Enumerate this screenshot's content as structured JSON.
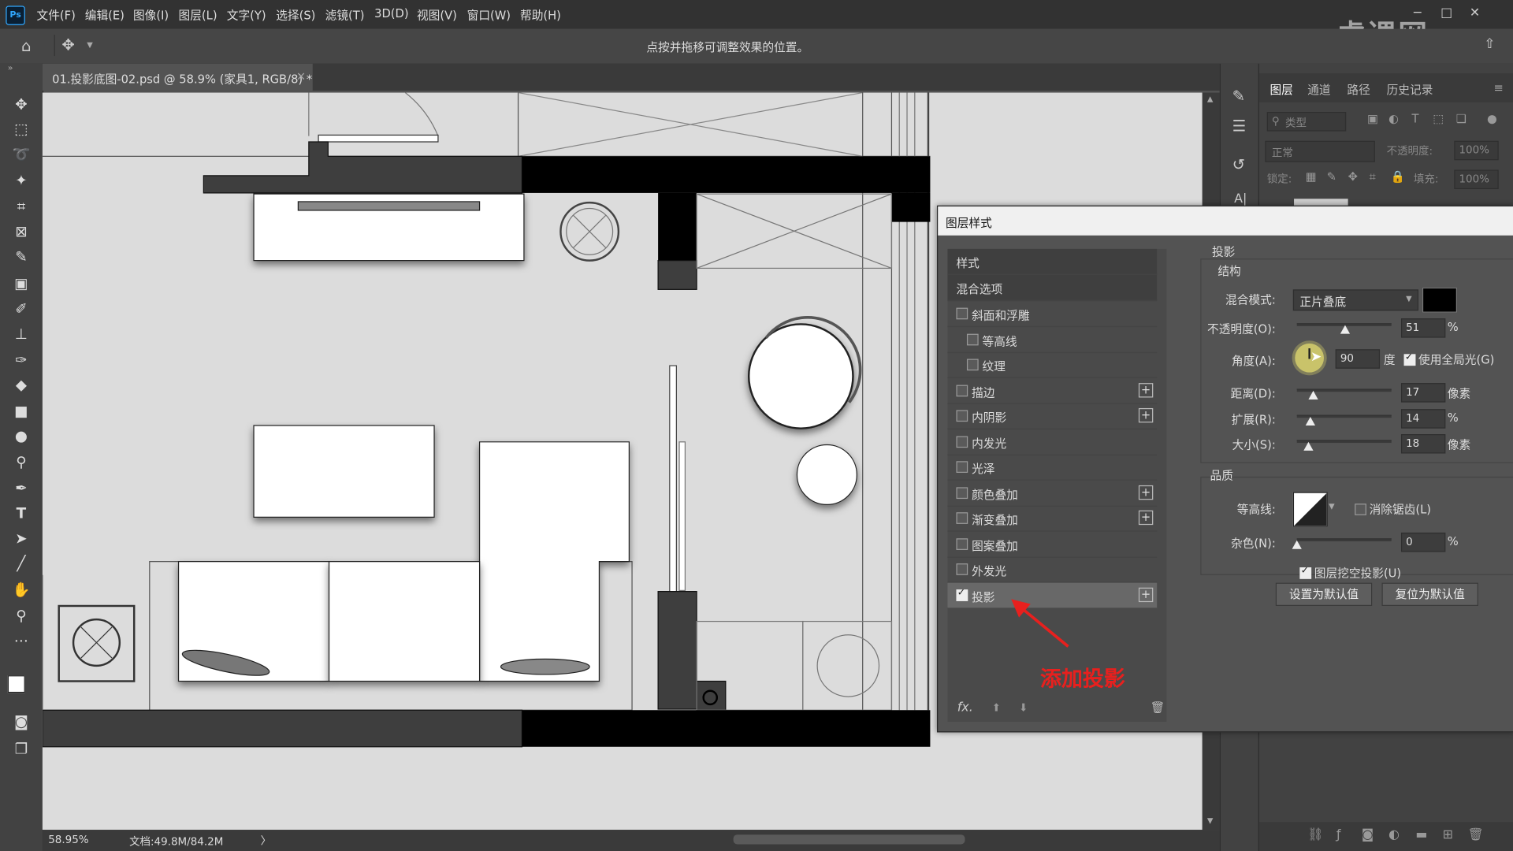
{
  "menu": {
    "logo": "Ps",
    "items": [
      "文件(F)",
      "编辑(E)",
      "图像(I)",
      "图层(L)",
      "文字(Y)",
      "选择(S)",
      "滤镜(T)",
      "3D(D)",
      "视图(V)",
      "窗口(W)",
      "帮助(H)"
    ]
  },
  "watermark": "虎课网",
  "options_bar": {
    "hint": "点按并拖移可调整效果的位置。"
  },
  "document": {
    "tab_title": "01.投影底图-02.psd @ 58.9% (家具1, RGB/8) *",
    "tab_close": "×"
  },
  "status": {
    "zoom": "58.95%",
    "doc_size": "文档:49.8M/84.2M",
    "arrow": "〉"
  },
  "layers_panel": {
    "tabs": [
      "图层",
      "通道",
      "路径",
      "历史记录"
    ],
    "filter_label": "类型",
    "blend_mode": "正常",
    "opacity_label": "不透明度:",
    "opacity_value": "100%",
    "lock_label": "锁定:",
    "fill_label": "填充:",
    "fill_value": "100%"
  },
  "dialog": {
    "title": "图层样式",
    "styles_header": "样式",
    "blend_options": "混合选项",
    "style_items": [
      {
        "label": "斜面和浮雕",
        "checked": false,
        "plus": false,
        "indent": false
      },
      {
        "label": "等高线",
        "checked": false,
        "plus": false,
        "indent": true
      },
      {
        "label": "纹理",
        "checked": false,
        "plus": false,
        "indent": true
      },
      {
        "label": "描边",
        "checked": false,
        "plus": true,
        "indent": false
      },
      {
        "label": "内阴影",
        "checked": false,
        "plus": true,
        "indent": false
      },
      {
        "label": "内发光",
        "checked": false,
        "plus": false,
        "indent": false
      },
      {
        "label": "光泽",
        "checked": false,
        "plus": false,
        "indent": false
      },
      {
        "label": "颜色叠加",
        "checked": false,
        "plus": true,
        "indent": false
      },
      {
        "label": "渐变叠加",
        "checked": false,
        "plus": true,
        "indent": false
      },
      {
        "label": "图案叠加",
        "checked": false,
        "plus": false,
        "indent": false
      },
      {
        "label": "外发光",
        "checked": false,
        "plus": false,
        "indent": false
      },
      {
        "label": "投影",
        "checked": true,
        "plus": true,
        "indent": false
      }
    ],
    "fx_label": "fx.",
    "annotation": "添加投影",
    "annotation_color": "#e8201e",
    "section_title": "投影",
    "structure_label": "结构",
    "blend_mode_label": "混合模式:",
    "blend_mode_value": "正片叠底",
    "shadow_color": "#000000",
    "opacity_label": "不透明度(O):",
    "opacity_value": "51",
    "opacity_unit": "%",
    "angle_label": "角度(A):",
    "angle_value": "90",
    "angle_unit": "度",
    "global_light_label": "使用全局光(G)",
    "global_light_checked": true,
    "distance_label": "距离(D):",
    "distance_value": "17",
    "distance_unit": "像素",
    "spread_label": "扩展(R):",
    "spread_value": "14",
    "spread_unit": "%",
    "size_label": "大小(S):",
    "size_value": "18",
    "size_unit": "像素",
    "quality_label": "品质",
    "contour_label": "等高线:",
    "antialias_label": "消除锯齿(L)",
    "antialias_checked": false,
    "noise_label": "杂色(N):",
    "noise_value": "0",
    "noise_unit": "%",
    "knockout_label": "图层挖空投影(U)",
    "knockout_checked": true,
    "set_default_button": "设置为默认值",
    "reset_default_button": "复位为默认值",
    "slider_levels": {
      "opacity": 0.51,
      "distance": 0.17,
      "spread": 0.14,
      "size": 0.12,
      "noise": 0.0
    }
  }
}
